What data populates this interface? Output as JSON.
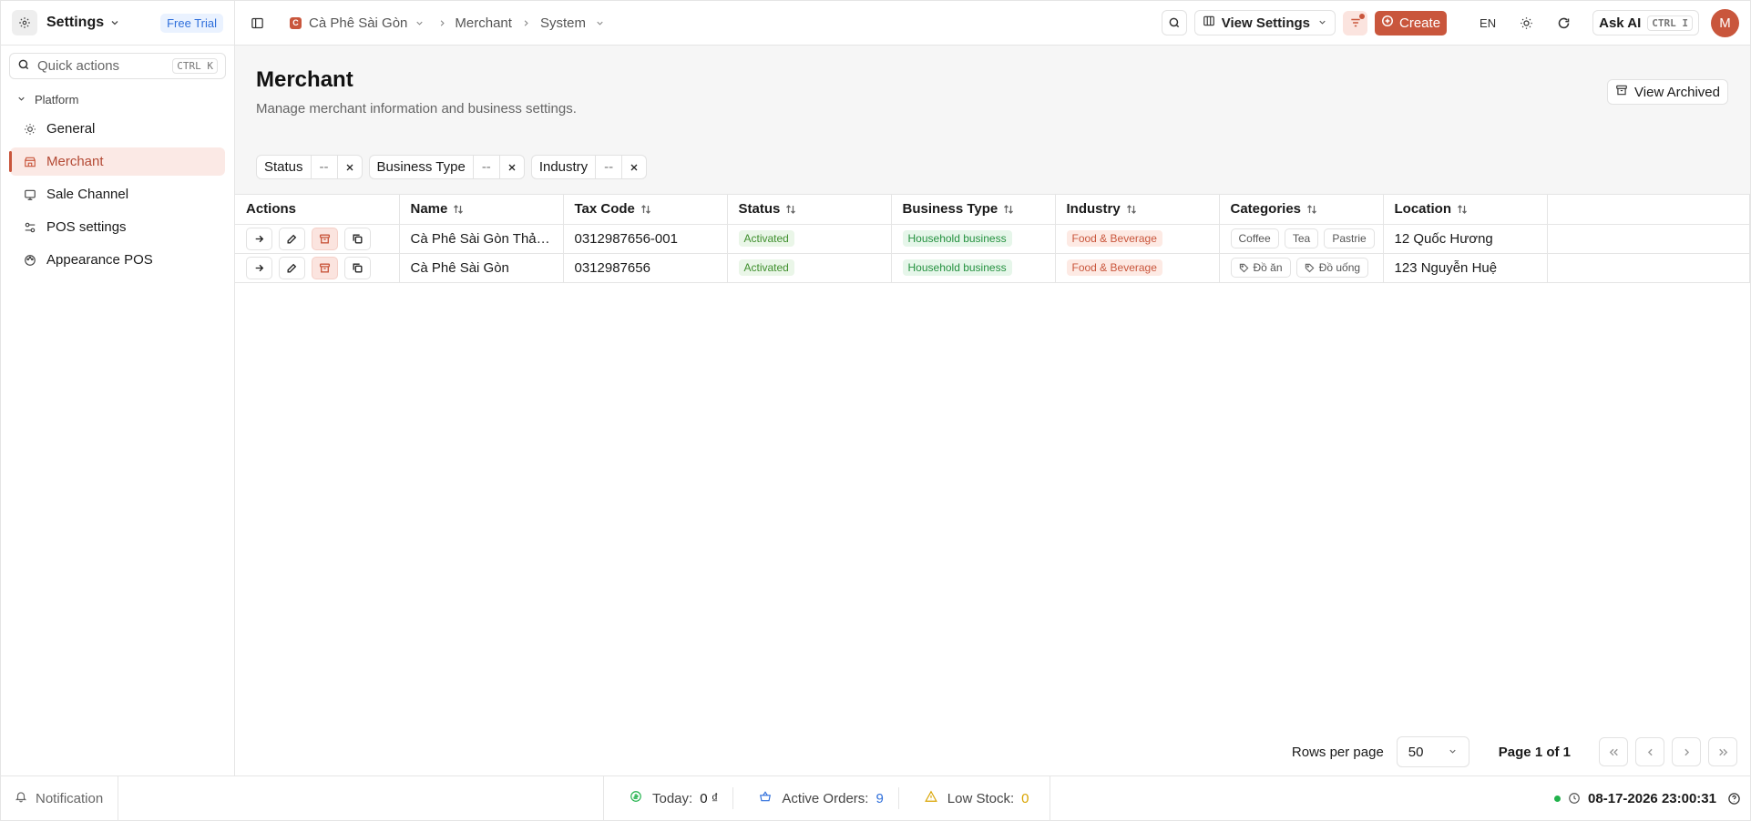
{
  "sidebar": {
    "title": "Settings",
    "badge": "Free Trial",
    "quick_actions": {
      "label": "Quick actions",
      "shortcut": "CTRL K"
    },
    "section": "Platform",
    "items": [
      {
        "label": "General",
        "icon": "sun-icon"
      },
      {
        "label": "Merchant",
        "icon": "store-icon",
        "active": true
      },
      {
        "label": "Sale Channel",
        "icon": "channel-icon"
      },
      {
        "label": "POS settings",
        "icon": "sliders-icon"
      },
      {
        "label": "Appearance POS",
        "icon": "palette-icon"
      }
    ]
  },
  "topbar": {
    "breadcrumb": {
      "store": "Cà Phê Sài Gòn",
      "store_initial": "C",
      "section": "Merchant",
      "page": "System"
    },
    "view_settings": "View Settings",
    "create": "Create",
    "language": "EN",
    "ask_ai": {
      "label": "Ask AI",
      "shortcut": "CTRL I"
    },
    "avatar": "M"
  },
  "page": {
    "title": "Merchant",
    "subtitle": "Manage merchant information and business settings.",
    "view_archived": "View Archived",
    "filters": [
      {
        "label": "Status",
        "value": "--"
      },
      {
        "label": "Business Type",
        "value": "--"
      },
      {
        "label": "Industry",
        "value": "--"
      }
    ]
  },
  "table": {
    "columns": [
      "Actions",
      "Name",
      "Tax Code",
      "Status",
      "Business Type",
      "Industry",
      "Categories",
      "Location"
    ],
    "rows": [
      {
        "name": "Cà Phê Sài Gòn Thảo...",
        "tax_code": "0312987656-001",
        "status": "Activated",
        "business_type": "Household business",
        "industry": "Food & Beverage",
        "categories": [
          "Coffee",
          "Tea",
          "Pastrie"
        ],
        "location": "12 Quốc Hương"
      },
      {
        "name": "Cà Phê Sài Gòn",
        "tax_code": "0312987656",
        "status": "Activated",
        "business_type": "Household business",
        "industry": "Food & Beverage",
        "categories": [
          "Đồ ăn",
          "Đồ uống"
        ],
        "location": "123 Nguyễn Huệ"
      }
    ]
  },
  "pagination": {
    "rows_per_page_label": "Rows per page",
    "rows_per_page": "50",
    "page_info": "Page 1 of 1"
  },
  "footer": {
    "notification": "Notification",
    "today": {
      "label": "Today:",
      "value": "0 ₫"
    },
    "active_orders": {
      "label": "Active Orders:",
      "value": "9"
    },
    "low_stock": {
      "label": "Low Stock:",
      "value": "0"
    },
    "datetime": "08-17-2026 23:00:31"
  },
  "colors": {
    "accent": "#c9563c",
    "status_green": "#3f8f2d",
    "info_blue": "#2f6fdb",
    "warning": "#d9a400"
  }
}
